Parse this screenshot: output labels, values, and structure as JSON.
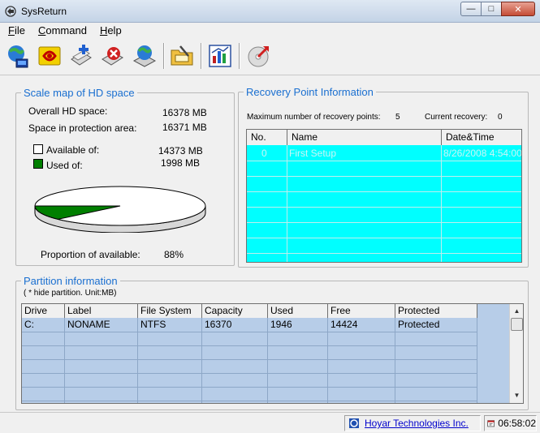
{
  "window": {
    "title": "SysReturn"
  },
  "menu": [
    {
      "label": "File",
      "underline": "F",
      "rest": "ile"
    },
    {
      "label": "Command",
      "underline": "C",
      "rest": "ommand"
    },
    {
      "label": "Help",
      "underline": "H",
      "rest": "elp"
    }
  ],
  "toolbar": {
    "icons": [
      "globe-network-icon",
      "recovery-point-icon",
      "add-disk-icon",
      "delete-icon",
      "global-restore-icon",
      "folder-tools-icon",
      "report-chart-icon",
      "cd-burn-icon"
    ]
  },
  "hd_space": {
    "title": "Scale map of HD space",
    "overall_label": "Overall HD space:",
    "overall_value": "16378 MB",
    "protection_label": "Space in protection area:",
    "protection_value": "16371 MB",
    "available_label": "Available of:",
    "available_value": "14373 MB",
    "used_label": "Used of:",
    "used_value": "1998 MB",
    "proportion_label": "Proportion of available:",
    "proportion_value": "88%",
    "pie_used_fraction": 0.12,
    "colors": {
      "available": "#ffffff",
      "used": "#007f00"
    }
  },
  "recovery": {
    "title": "Recovery Point Information",
    "max_label": "Maximum number of recovery points:",
    "max_value": "5",
    "current_label": "Current recovery:",
    "current_value": "0",
    "columns": [
      "No.",
      "Name",
      "Date&Time"
    ],
    "rows": [
      {
        "no": "0",
        "name": "First Setup",
        "datetime": "8/26/2008 4:54:00"
      }
    ],
    "bg_color": "#00ffff"
  },
  "partition": {
    "title": "Partition information",
    "hint": "( * hide partition.   Unit:MB)",
    "columns": [
      "Drive",
      "Label",
      "File System",
      "Capacity",
      "Used",
      "Free",
      "Protected"
    ],
    "rows": [
      {
        "drive": "C:",
        "label": "NONAME",
        "fs": "NTFS",
        "capacity": "16370",
        "used": "1946",
        "free": "14424",
        "protected": "Protected"
      }
    ]
  },
  "status": {
    "company": "Hoyar Technologies Inc.",
    "time": "06:58:02"
  }
}
